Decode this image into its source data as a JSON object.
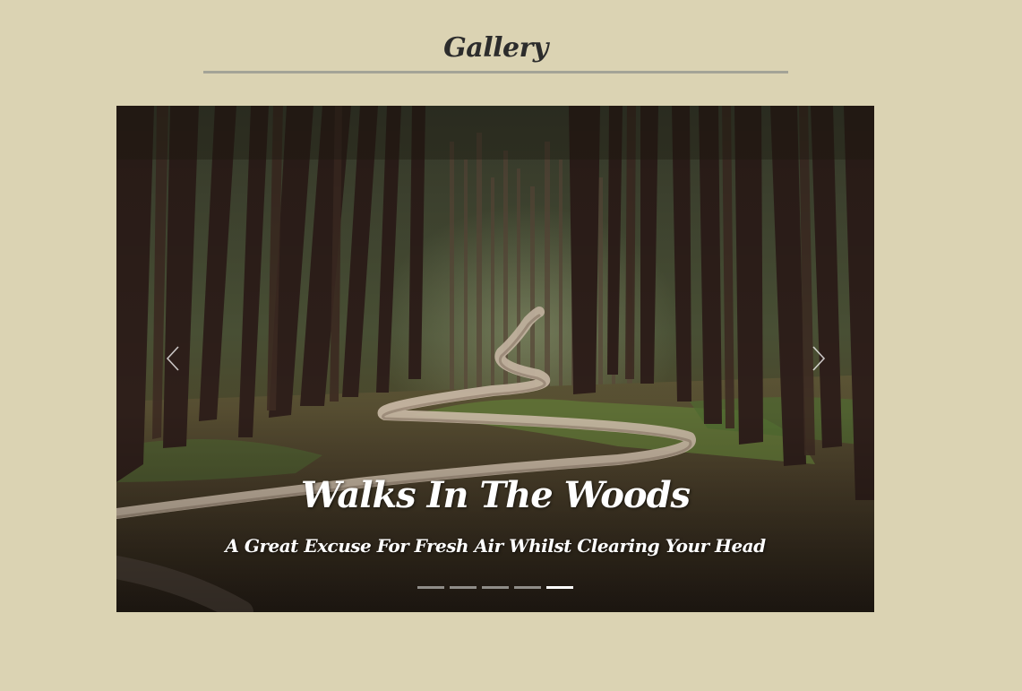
{
  "header": {
    "title": "Gallery"
  },
  "carousel": {
    "slide": {
      "image_subject": "forest path winding between tall trees",
      "caption_title": "Walks In The Woods",
      "caption_subtitle": "A Great Excuse For Fresh Air Whilst Clearing Your Head"
    },
    "controls": {
      "prev_icon": "chevron-left-icon",
      "next_icon": "chevron-right-icon"
    },
    "indicators": {
      "count": 5,
      "active_index": 4
    }
  },
  "colors": {
    "page_background": "#dbd3b3",
    "title_text": "#2c2c2c",
    "title_rule": "#a3a397",
    "caption_text": "#ffffff"
  }
}
